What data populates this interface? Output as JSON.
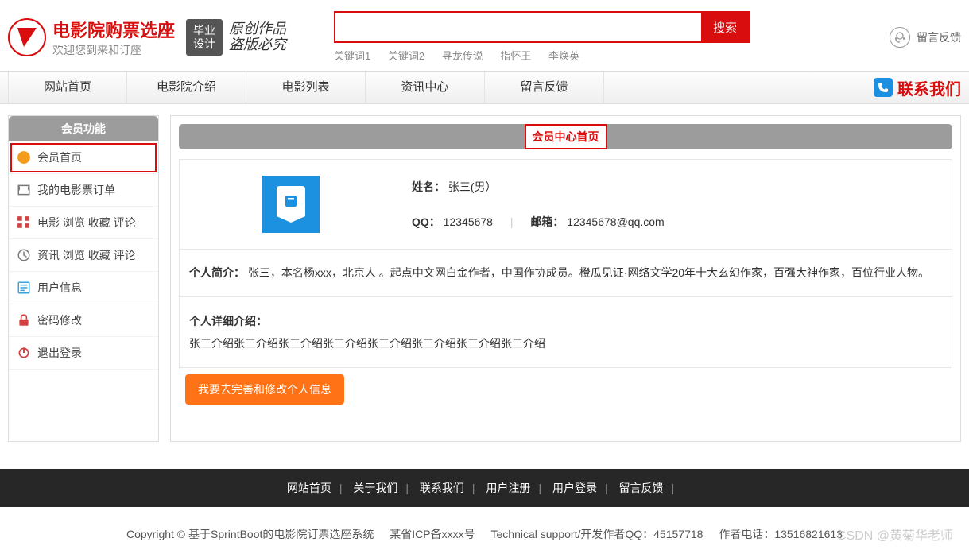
{
  "header": {
    "logo_title": "电影院购票选座",
    "logo_sub": "欢迎您到来和订座",
    "stamp1_line1": "毕业",
    "stamp1_line2": "设计",
    "stamp2_line1": "原创作品",
    "stamp2_line2": "盗版必究",
    "search_placeholder": "",
    "search_button": "搜索",
    "hot_words": [
      "关键词1",
      "关键词2",
      "寻龙传说",
      "指怀王",
      "李焕英"
    ],
    "feedback_label": "留言反馈"
  },
  "nav": {
    "items": [
      "网站首页",
      "电影院介绍",
      "电影列表",
      "资讯中心",
      "留言反馈"
    ],
    "contact": "联系我们"
  },
  "sidebar": {
    "title": "会员功能",
    "items": [
      {
        "label": "会员首页",
        "icon": "home",
        "color": "orange",
        "active": true
      },
      {
        "label": "我的电影票订单",
        "icon": "ticket",
        "color": "gray"
      },
      {
        "label": "电影 浏览 收藏 评论",
        "icon": "grid",
        "color": "red"
      },
      {
        "label": "资讯 浏览 收藏 评论",
        "icon": "clock",
        "color": "gray"
      },
      {
        "label": "用户信息",
        "icon": "user",
        "color": "blue"
      },
      {
        "label": "密码修改",
        "icon": "lock",
        "color": "red"
      },
      {
        "label": "退出登录",
        "icon": "power",
        "color": "red"
      }
    ]
  },
  "content": {
    "title": "会员中心首页",
    "name_label": "姓名：",
    "name_value": "张三(男）",
    "qq_label": "QQ：",
    "qq_value": "12345678",
    "email_label": "邮箱：",
    "email_value": "12345678@qq.com",
    "intro_label": "个人简介：",
    "intro_value": "张三，本名杨xxx，北京人 。起点中文网白金作者，中国作协成员。橙瓜见证·网络文学20年十大玄幻作家，百强大神作家，百位行业人物。",
    "detail_label": "个人详细介绍：",
    "detail_value": "张三介绍张三介绍张三介绍张三介绍张三介绍张三介绍张三介绍张三介绍",
    "edit_button": "我要去完善和修改个人信息"
  },
  "footer_nav": [
    "网站首页",
    "关于我们",
    "联系我们",
    "用户注册",
    "用户登录",
    "留言反馈"
  ],
  "copyright": {
    "text": "Copyright © 基于SprintBoot的电影院订票选座系统",
    "icp": "某省ICP备xxxx号",
    "support": "Technical support/开发作者QQ：45157718",
    "phone": "作者电话：13516821613"
  },
  "watermark": "CSDN @黄菊华老师"
}
